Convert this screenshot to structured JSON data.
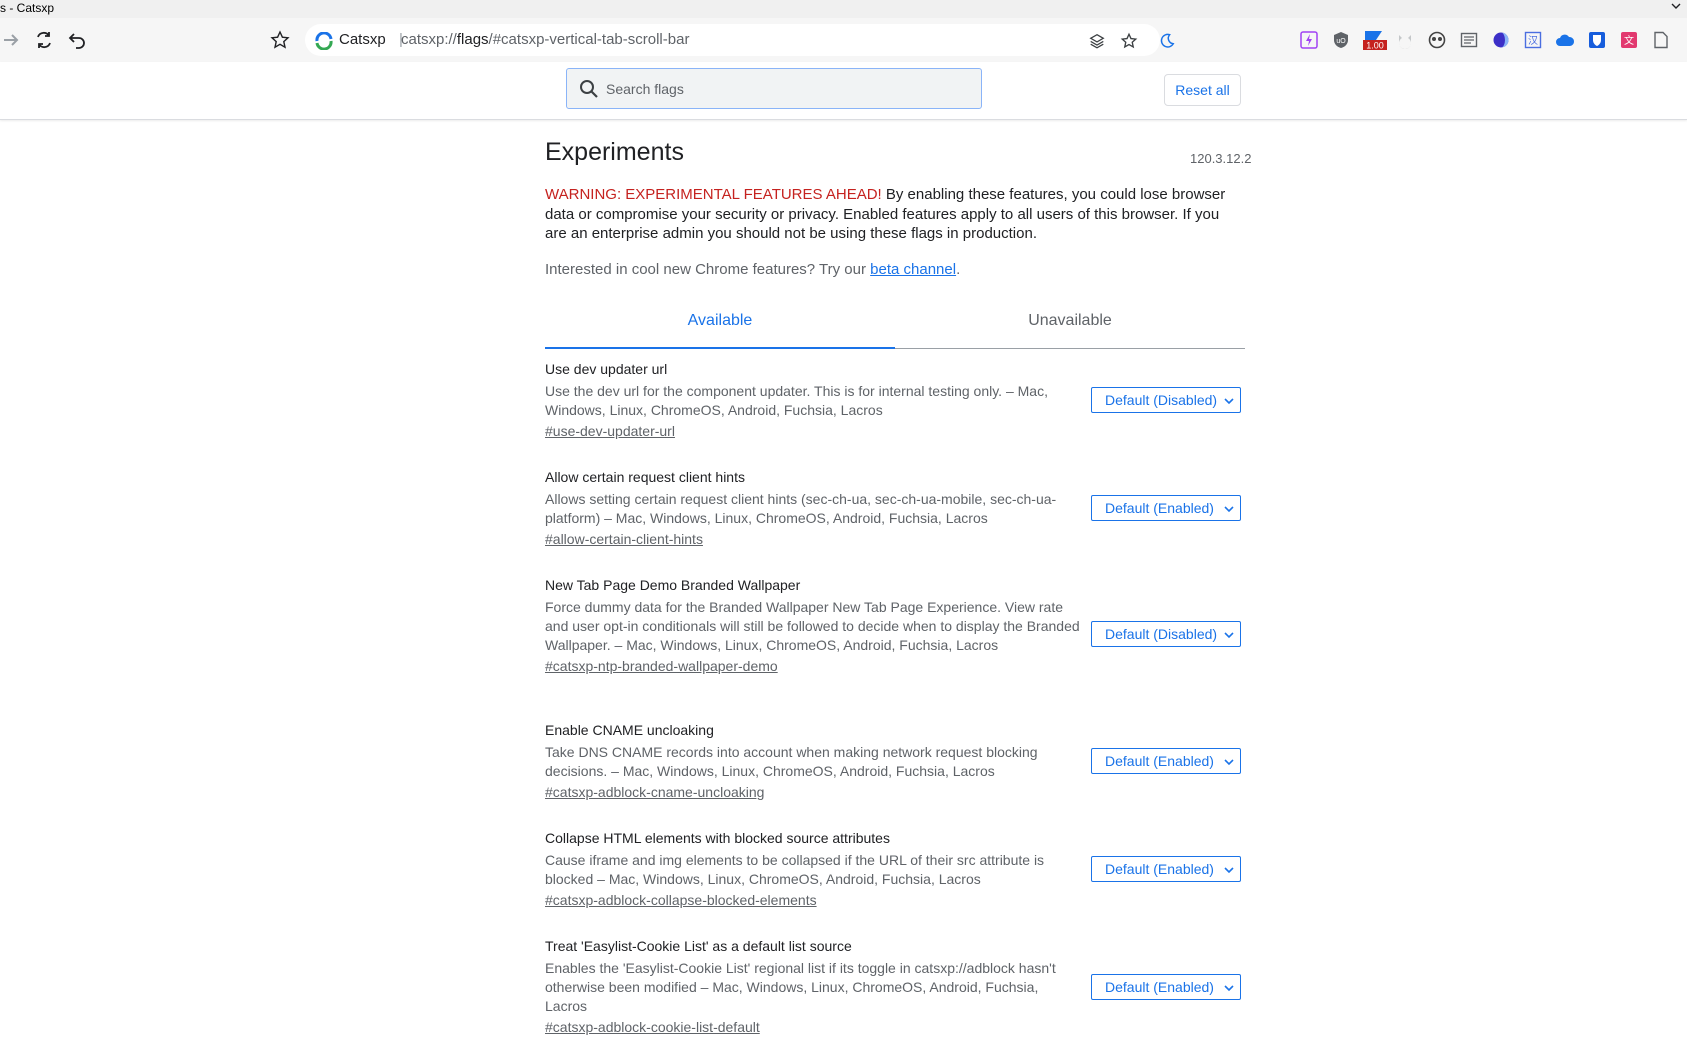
{
  "window": {
    "title": "s - Catsxp"
  },
  "omnibox": {
    "site_name": "Catsxp",
    "separator": "|",
    "url_scheme": "catsxp://",
    "url_host": "flags",
    "url_rest": "/#catsxp-vertical-tab-scroll-bar"
  },
  "toolbar_icons": [
    "forward-icon",
    "reload-icon",
    "back-icon",
    "bookmark-star-icon"
  ],
  "omnibox_right_icons": [
    "leo-stack-icon",
    "star-icon",
    "moon-icon"
  ],
  "extensions": [
    {
      "name": "purple-extension-icon",
      "color": "#a142f4"
    },
    {
      "name": "ublock-icon",
      "color": "#5f6368"
    },
    {
      "name": "badge-extension-icon",
      "color": "#1a73e8",
      "badge": "1.00"
    },
    {
      "name": "cat-extension-icon",
      "color": "#9aa0a6"
    },
    {
      "name": "owl-extension-icon",
      "color": "#444"
    },
    {
      "name": "reader-extension-icon",
      "color": "#5f6368"
    },
    {
      "name": "half-moon-extension-icon",
      "color": "#3c2fc7"
    },
    {
      "name": "translate-extension-icon",
      "color": "#4a6ee0"
    },
    {
      "name": "cloud-extension-icon",
      "color": "#1a73e8"
    },
    {
      "name": "bitwarden-icon",
      "color": "#175ddc"
    },
    {
      "name": "translate-red-extension-icon",
      "color": "#e2396f"
    },
    {
      "name": "doc-extension-icon",
      "color": "#5f6368"
    }
  ],
  "search": {
    "placeholder": "Search flags"
  },
  "reset_label": "Reset all",
  "page_title": "Experiments",
  "version": "120.3.12.2",
  "warning": {
    "prefix": "WARNING: EXPERIMENTAL FEATURES AHEAD!",
    "body": " By enabling these features, you could lose browser data or compromise your security or privacy. Enabled features apply to all users of this browser. If you are an enterprise admin you should not be using these flags in production."
  },
  "interested": {
    "text": "Interested in cool new Chrome features? Try our ",
    "link": "beta channel",
    "suffix": "."
  },
  "tabs": {
    "available": "Available",
    "unavailable": "Unavailable"
  },
  "flags": [
    {
      "name": "Use dev updater url",
      "desc": "Use the dev url for the component updater. This is for internal testing only. – Mac, Windows, Linux, ChromeOS, Android, Fuchsia, Lacros",
      "link": "#use-dev-updater-url",
      "value": "Default (Disabled)"
    },
    {
      "name": "Allow certain request client hints",
      "desc": "Allows setting certain request client hints (sec-ch-ua, sec-ch-ua-mobile, sec-ch-ua-platform) – Mac, Windows, Linux, ChromeOS, Android, Fuchsia, Lacros",
      "link": "#allow-certain-client-hints",
      "value": "Default (Enabled)"
    },
    {
      "name": "New Tab Page Demo Branded Wallpaper",
      "desc": "Force dummy data for the Branded Wallpaper New Tab Page Experience. View rate and user opt-in conditionals will still be followed to decide when to display the Branded Wallpaper. – Mac, Windows, Linux, ChromeOS, Android, Fuchsia, Lacros",
      "link": "#catsxp-ntp-branded-wallpaper-demo",
      "value": "Default (Disabled)"
    },
    {
      "name": "Enable CNAME uncloaking",
      "desc": "Take DNS CNAME records into account when making network request blocking decisions. – Mac, Windows, Linux, ChromeOS, Android, Fuchsia, Lacros",
      "link": "#catsxp-adblock-cname-uncloaking",
      "value": "Default (Enabled)"
    },
    {
      "name": "Collapse HTML elements with blocked source attributes",
      "desc": "Cause iframe and img elements to be collapsed if the URL of their src attribute is blocked – Mac, Windows, Linux, ChromeOS, Android, Fuchsia, Lacros",
      "link": "#catsxp-adblock-collapse-blocked-elements",
      "value": "Default (Enabled)"
    },
    {
      "name": "Treat 'Easylist-Cookie List' as a default list source",
      "desc": "Enables the 'Easylist-Cookie List' regional list if its toggle in catsxp://adblock hasn't otherwise been modified – Mac, Windows, Linux, ChromeOS, Android, Fuchsia, Lacros",
      "link": "#catsxp-adblock-cookie-list-default",
      "value": "Default (Enabled)"
    }
  ]
}
